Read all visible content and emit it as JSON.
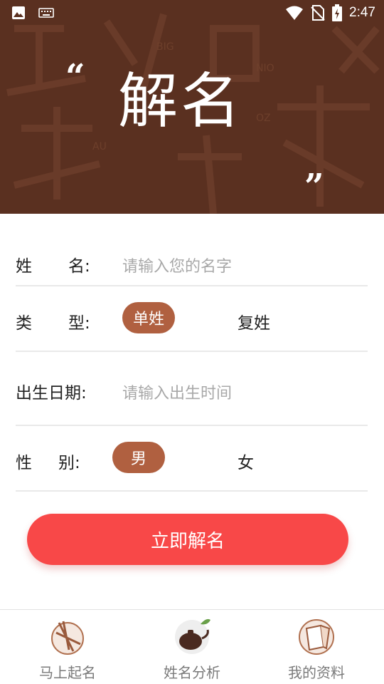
{
  "status_bar": {
    "time": "2:47",
    "icons": [
      "image-icon",
      "keyboard-icon",
      "wifi-icon",
      "no-sim-icon",
      "battery-charging-icon"
    ]
  },
  "hero": {
    "title": "解名",
    "open_quote": "“",
    "close_quote": "”",
    "background_color": "#5a3020"
  },
  "form": {
    "name": {
      "label_a": "姓",
      "label_b": "名:",
      "placeholder": "请输入您的名字"
    },
    "type": {
      "label_a": "类",
      "label_b": "型:",
      "options": [
        "单姓",
        "复姓"
      ],
      "selected": "单姓"
    },
    "birth": {
      "label": "出生日期:",
      "placeholder": "请输入出生时间"
    },
    "gender": {
      "label_a": "性",
      "label_b": "别:",
      "options": [
        "男",
        "女"
      ],
      "selected": "男"
    }
  },
  "submit_label": "立即解名",
  "bottom_nav": {
    "items": [
      {
        "label": "马上起名",
        "icon": "brush-icon"
      },
      {
        "label": "姓名分析",
        "icon": "teapot-icon"
      },
      {
        "label": "我的资料",
        "icon": "book-icon"
      }
    ]
  },
  "colors": {
    "accent_pill": "#b06040",
    "submit": "#f84848"
  }
}
